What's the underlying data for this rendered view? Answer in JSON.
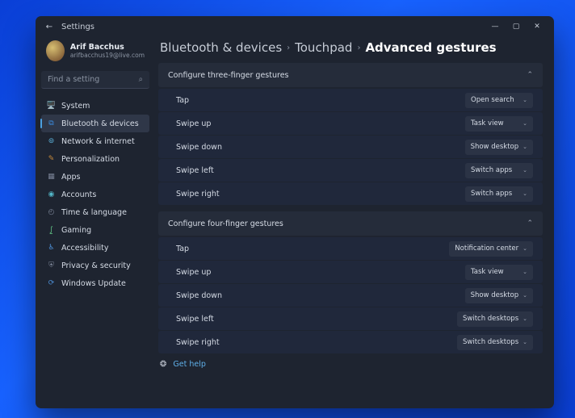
{
  "titlebar": {
    "title": "Settings"
  },
  "profile": {
    "name": "Arif Bacchus",
    "email": "arifbacchus19@live.com"
  },
  "search": {
    "placeholder": "Find a setting"
  },
  "sidebar": {
    "items": [
      {
        "label": "System",
        "icon": "🖥️",
        "color": "#4c8fd6"
      },
      {
        "label": "Bluetooth & devices",
        "icon": "⧉",
        "color": "#3a8ce0",
        "active": true
      },
      {
        "label": "Network & internet",
        "icon": "⊚",
        "color": "#5bb0d8"
      },
      {
        "label": "Personalization",
        "icon": "✎",
        "color": "#c6893a"
      },
      {
        "label": "Apps",
        "icon": "▦",
        "color": "#7a8396"
      },
      {
        "label": "Accounts",
        "icon": "◉",
        "color": "#53b7c8"
      },
      {
        "label": "Time & language",
        "icon": "◴",
        "color": "#7a8396"
      },
      {
        "label": "Gaming",
        "icon": "⨜",
        "color": "#62c888"
      },
      {
        "label": "Accessibility",
        "icon": "♿",
        "color": "#4c8fd6"
      },
      {
        "label": "Privacy & security",
        "icon": "⛨",
        "color": "#7a8396"
      },
      {
        "label": "Windows Update",
        "icon": "⟳",
        "color": "#4c8fd6"
      }
    ]
  },
  "breadcrumb": {
    "items": [
      "Bluetooth & devices",
      "Touchpad"
    ],
    "current": "Advanced gestures"
  },
  "sections": [
    {
      "title": "Configure three-finger gestures",
      "rows": [
        {
          "label": "Tap",
          "value": "Open search"
        },
        {
          "label": "Swipe up",
          "value": "Task view"
        },
        {
          "label": "Swipe down",
          "value": "Show desktop"
        },
        {
          "label": "Swipe left",
          "value": "Switch apps"
        },
        {
          "label": "Swipe right",
          "value": "Switch apps"
        }
      ]
    },
    {
      "title": "Configure four-finger gestures",
      "rows": [
        {
          "label": "Tap",
          "value": "Notification center"
        },
        {
          "label": "Swipe up",
          "value": "Task view"
        },
        {
          "label": "Swipe down",
          "value": "Show desktop"
        },
        {
          "label": "Swipe left",
          "value": "Switch desktops"
        },
        {
          "label": "Swipe right",
          "value": "Switch desktops"
        }
      ]
    }
  ],
  "help": {
    "label": "Get help"
  }
}
